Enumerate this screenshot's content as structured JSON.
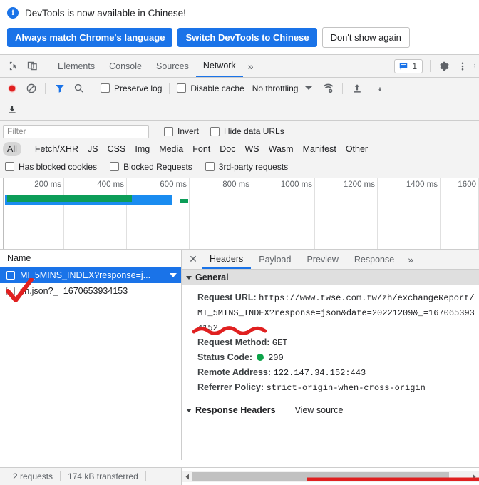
{
  "infobar": {
    "icon": "info-icon",
    "message": "DevTools is now available in Chinese!",
    "buttons": [
      {
        "label": "Always match Chrome's language",
        "style": "primary"
      },
      {
        "label": "Switch DevTools to Chinese",
        "style": "primary"
      },
      {
        "label": "Don't show again",
        "style": "secondary"
      }
    ]
  },
  "tabbar": {
    "inspect_icon": "inspect-element-icon",
    "device_icon": "device-toolbar-icon",
    "tabs": [
      {
        "label": "Elements",
        "active": false
      },
      {
        "label": "Console",
        "active": false
      },
      {
        "label": "Sources",
        "active": false
      },
      {
        "label": "Network",
        "active": true
      }
    ],
    "more_label": "»",
    "message_count": "1",
    "message_icon": "message-bubble-icon",
    "settings_icon": "gear-icon",
    "menu_icon": "kebab-menu-icon"
  },
  "network_toolbar": {
    "record_icon": "record-button-icon",
    "clear_icon": "clear-network-icon",
    "filter_icon": "filter-funnel-icon",
    "search_icon": "search-icon",
    "preserve_log": {
      "label": "Preserve log",
      "checked": false
    },
    "disable_cache": {
      "label": "Disable cache",
      "checked": false
    },
    "throttling": {
      "label": "No throttling"
    },
    "wifi_icon": "network-conditions-icon",
    "import_icon": "import-har-icon",
    "export_icon": "export-har-icon",
    "download_icon": "download-har-icon"
  },
  "filterbar": {
    "filter_placeholder": "Filter",
    "filter_value": "",
    "invert": {
      "label": "Invert",
      "checked": false
    },
    "hide_data_urls": {
      "label": "Hide data URLs",
      "checked": false
    },
    "types": [
      {
        "label": "All",
        "active": true
      },
      {
        "label": "Fetch/XHR",
        "active": false
      },
      {
        "label": "JS",
        "active": false
      },
      {
        "label": "CSS",
        "active": false
      },
      {
        "label": "Img",
        "active": false
      },
      {
        "label": "Media",
        "active": false
      },
      {
        "label": "Font",
        "active": false
      },
      {
        "label": "Doc",
        "active": false
      },
      {
        "label": "WS",
        "active": false
      },
      {
        "label": "Wasm",
        "active": false
      },
      {
        "label": "Manifest",
        "active": false
      },
      {
        "label": "Other",
        "active": false
      }
    ],
    "has_blocked_cookies": {
      "label": "Has blocked cookies",
      "checked": false
    },
    "blocked_requests": {
      "label": "Blocked Requests",
      "checked": false
    },
    "third_party": {
      "label": "3rd-party requests",
      "checked": false
    }
  },
  "overview": {
    "ticks": [
      "200 ms",
      "400 ms",
      "600 ms",
      "800 ms",
      "1000 ms",
      "1200 ms",
      "1400 ms",
      "1600"
    ],
    "bar_green_color": "#0c9d58",
    "bar_blue_color": "#1a8cf0"
  },
  "requests_panel": {
    "column_header": "Name",
    "rows": [
      {
        "name": "MI_5MINS_INDEX?response=j...",
        "selected": true,
        "checked": true
      },
      {
        "name": "zh.json?_=1670653934153",
        "selected": false,
        "checked": false
      }
    ]
  },
  "details_panel": {
    "close_label": "✕",
    "tabs": [
      {
        "label": "Headers",
        "active": true
      },
      {
        "label": "Payload",
        "active": false
      },
      {
        "label": "Preview",
        "active": false
      },
      {
        "label": "Response",
        "active": false
      }
    ],
    "more_label": "»",
    "general": {
      "section_title": "General",
      "rows": [
        {
          "key": "Request URL:",
          "value": "https://www.twse.com.tw/zh/exchangeReport/MI_5MINS_INDEX?response=json&date=20221209&_=1670653934152",
          "annotated": true
        },
        {
          "key": "Request Method:",
          "value": "GET"
        },
        {
          "key": "Status Code:",
          "value": "200",
          "status_dot": "#0ca349"
        },
        {
          "key": "Remote Address:",
          "value": "122.147.34.152:443"
        },
        {
          "key": "Referrer Policy:",
          "value": "strict-origin-when-cross-origin"
        }
      ]
    },
    "response_headers": {
      "section_title": "Response Headers",
      "view_source_label": "View source"
    }
  },
  "status_bar": {
    "requests": "2 requests",
    "transferred": "174 kB transferred"
  },
  "annotations": {
    "checkmark_color": "#e02020",
    "squiggle_color": "#e02020"
  }
}
